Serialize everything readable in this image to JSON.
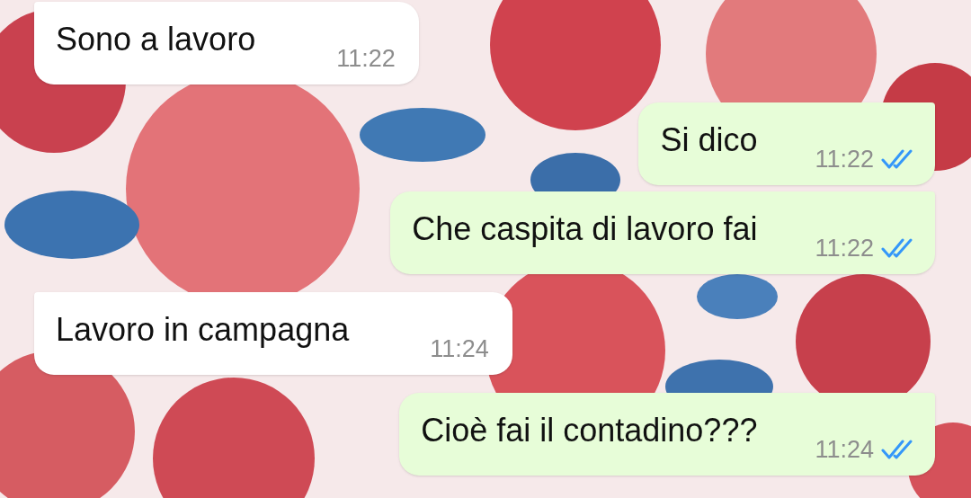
{
  "messages": [
    {
      "kind": "incoming",
      "text": "Sono a lavoro",
      "time": "11:22"
    },
    {
      "kind": "outgoing",
      "text": "Si dico",
      "time": "11:22",
      "read": true
    },
    {
      "kind": "outgoing",
      "text": "Che caspita di lavoro fai",
      "time": "11:22",
      "read": true
    },
    {
      "kind": "incoming",
      "text": "Lavoro in campagna",
      "time": "11:24"
    },
    {
      "kind": "outgoing",
      "text": "Cioè fai il contadino???",
      "time": "11:24",
      "read": true
    }
  ]
}
